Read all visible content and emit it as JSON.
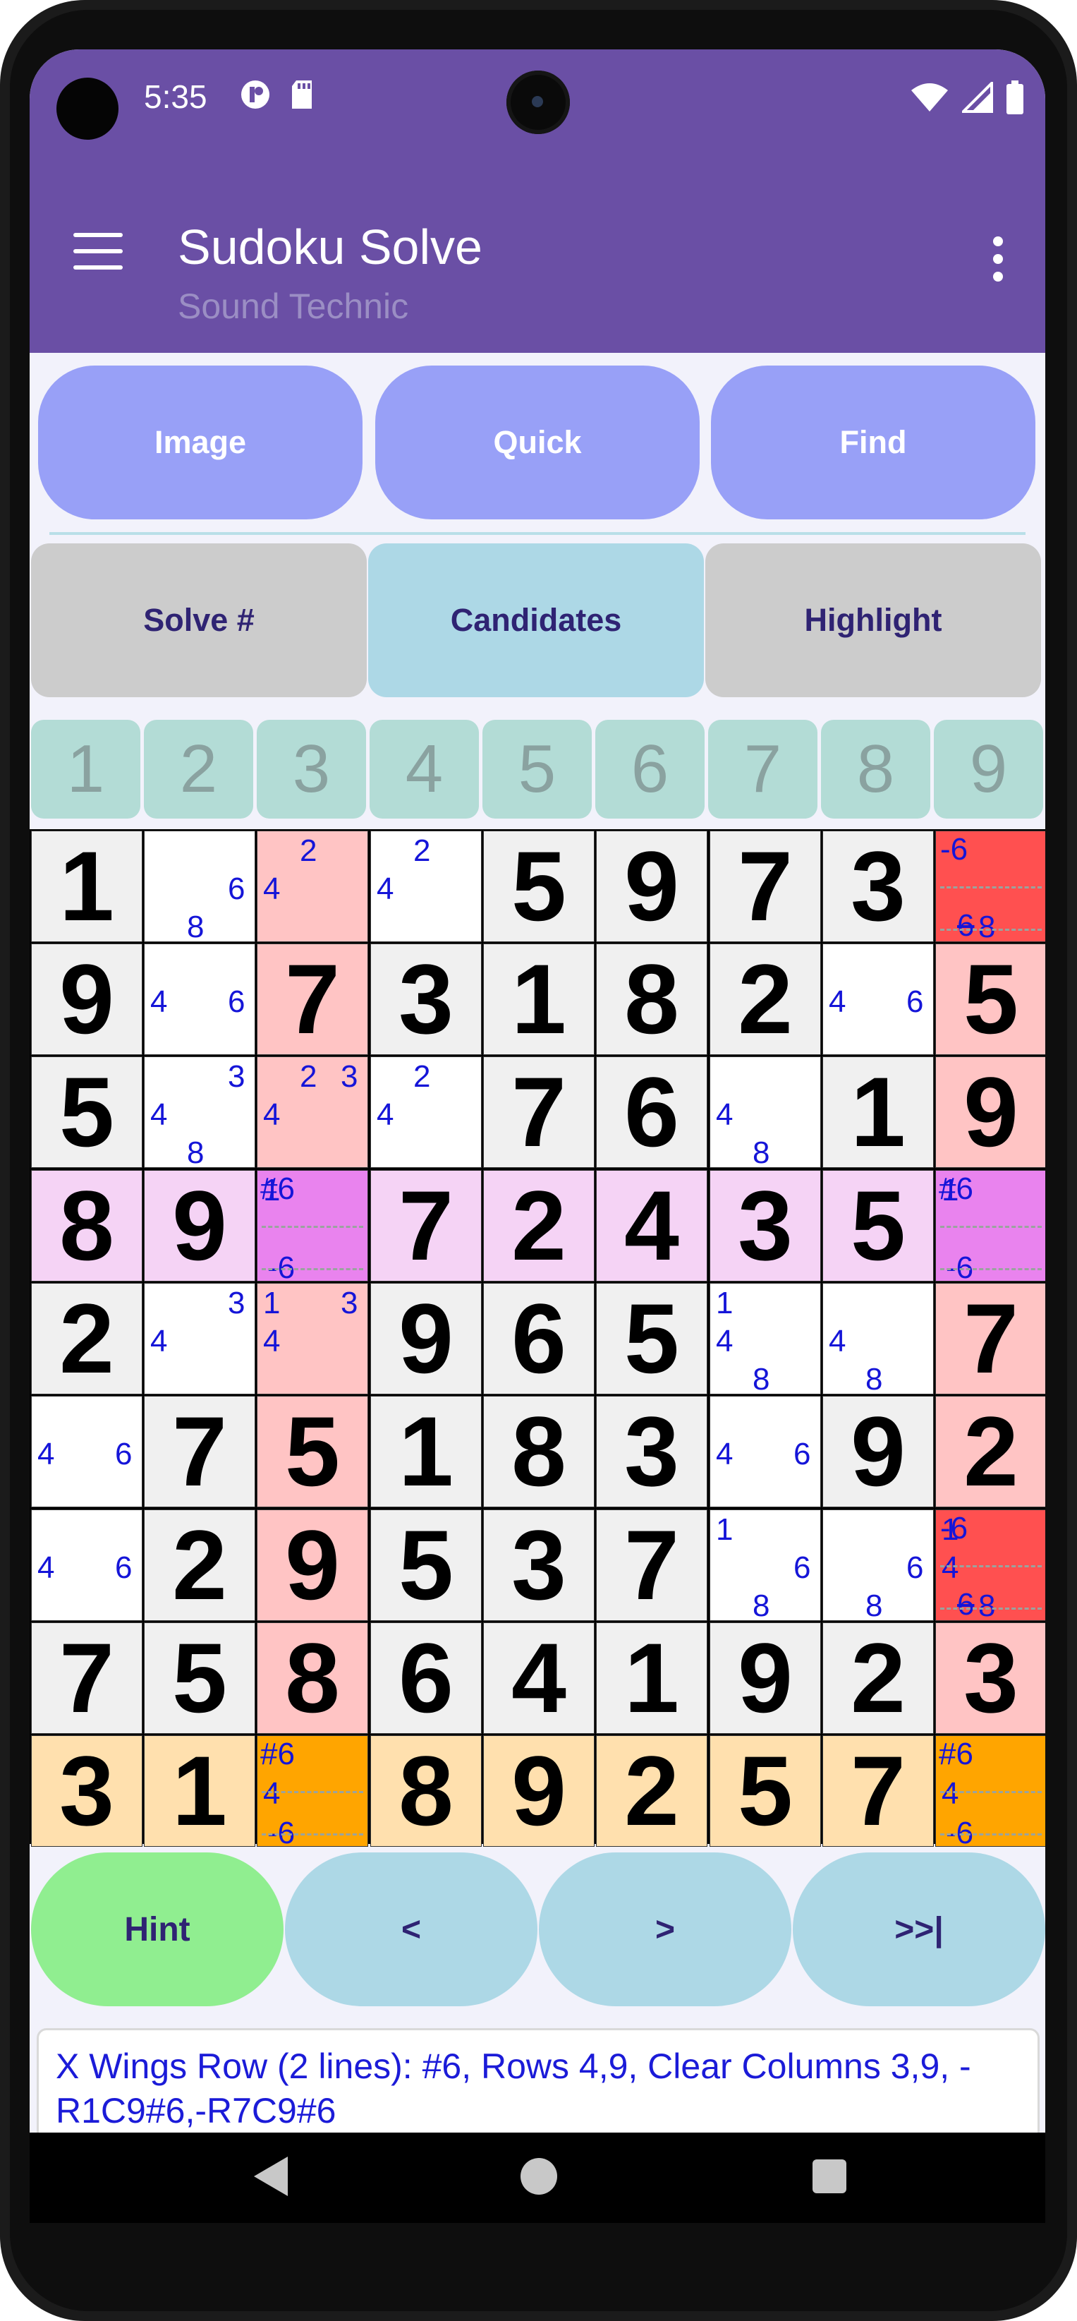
{
  "status": {
    "time": "5:35"
  },
  "app": {
    "title": "Sudoku Solve",
    "subtitle": "Sound Technic"
  },
  "top_buttons": {
    "image": "Image",
    "quick": "Quick",
    "find": "Find"
  },
  "mode_buttons": {
    "solve": "Solve #",
    "candidates": "Candidates",
    "highlight": "Highlight"
  },
  "column_headers": [
    "1",
    "2",
    "3",
    "4",
    "5",
    "6",
    "7",
    "8",
    "9"
  ],
  "grid": {
    "values": [
      [
        "1",
        "",
        "",
        "",
        "5",
        "9",
        "7",
        "3",
        ""
      ],
      [
        "9",
        "",
        "7",
        "3",
        "1",
        "8",
        "2",
        "",
        "5"
      ],
      [
        "5",
        "",
        "",
        "",
        "7",
        "6",
        "",
        "1",
        "9"
      ],
      [
        "8",
        "9",
        "",
        "7",
        "2",
        "4",
        "3",
        "5",
        ""
      ],
      [
        "2",
        "",
        "",
        "9",
        "6",
        "5",
        "",
        "",
        "7"
      ],
      [
        "",
        "7",
        "5",
        "1",
        "8",
        "3",
        "",
        "9",
        "2"
      ],
      [
        "",
        "2",
        "9",
        "5",
        "3",
        "7",
        "",
        "",
        ""
      ],
      [
        "7",
        "5",
        "8",
        "6",
        "4",
        "1",
        "9",
        "2",
        "3"
      ],
      [
        "3",
        "1",
        "",
        "8",
        "9",
        "2",
        "5",
        "7",
        ""
      ]
    ],
    "candidates": {
      "r1c2": [
        "6",
        "8"
      ],
      "r1c3": [
        "2",
        "4"
      ],
      "r1c4": [
        "2",
        "4"
      ],
      "r1c9": [
        "-6",
        "6",
        "8"
      ],
      "r2c2": [
        "4",
        "6"
      ],
      "r2c8": [
        "4",
        "6"
      ],
      "r3c2": [
        "3",
        "4",
        "8"
      ],
      "r3c3": [
        "2",
        "3",
        "4"
      ],
      "r3c4": [
        "2",
        "4"
      ],
      "r3c7": [
        "4",
        "8"
      ],
      "r4c3": [
        "#6",
        "1",
        "-6"
      ],
      "r4c9": [
        "#6",
        "1",
        "-6"
      ],
      "r5c2": [
        "3",
        "4"
      ],
      "r5c3": [
        "1",
        "3",
        "4"
      ],
      "r5c7": [
        "1",
        "4",
        "8"
      ],
      "r5c8": [
        "4",
        "8"
      ],
      "r6c1": [
        "4",
        "6"
      ],
      "r6c7": [
        "4",
        "6"
      ],
      "r7c1": [
        "4",
        "6"
      ],
      "r7c7": [
        "1",
        "6",
        "8"
      ],
      "r7c8": [
        "6",
        "8"
      ],
      "r7c9": [
        "-6",
        "1",
        "4",
        "6",
        "8"
      ],
      "r9c3": [
        "#6",
        "4",
        "-6"
      ],
      "r9c9": [
        "#6",
        "4",
        "-6"
      ]
    }
  },
  "nav_buttons": {
    "hint": "Hint",
    "prev": "<",
    "next": ">",
    "end": ">>|"
  },
  "message": "X Wings Row (2 lines): #6, Rows 4,9, Clear Columns 3,9, -R1C9#6,-R7C9#6",
  "colors": {
    "appbar": "#6a4fa5",
    "top_button": "#98a0f7",
    "candidates_btn": "#add8e6",
    "grey_btn": "#cccccc",
    "hint": "#90ee90",
    "nav_btn": "#add8e6",
    "given_cell": "#f0f0f0",
    "col_highlight": "#ffc4c4",
    "clear_cell": "#ff5050",
    "row4": "#f5d3f5",
    "row4_key": "#e983ee",
    "row9": "#ffe0ae",
    "row9_key": "#ffa500"
  }
}
